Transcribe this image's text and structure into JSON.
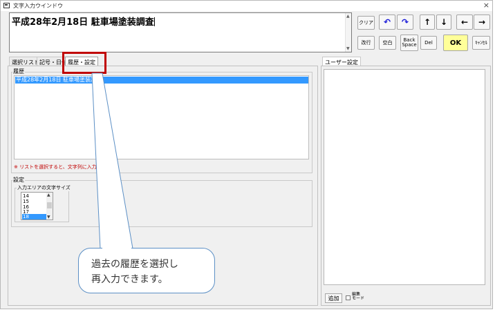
{
  "window": {
    "title": "文字入力ウインドウ",
    "close": "×"
  },
  "input": {
    "text": "平成28年2月18日 駐車場塗装調査"
  },
  "buttons": {
    "clear": "クリア",
    "undo": "↶",
    "redo": "↷",
    "up": "↑",
    "down": "↓",
    "left": "←",
    "right": "→",
    "newline": "改行",
    "space": "空白",
    "backspace_1": "Back",
    "backspace_2": "Space",
    "del": "Del",
    "ok": "OK",
    "cancel": "ｷｬﾝｾﾙ"
  },
  "tabs": [
    "選択リスト",
    "記号・日付",
    "履歴・設定"
  ],
  "history": {
    "group_label": "履歴",
    "items": [
      "平成28年2月18日 駐車場塗装調査"
    ],
    "note": "※ リストを選択すると、文字列に入力されます。"
  },
  "settings": {
    "group_label": "設定",
    "font_group_label": "入力エリアの文字サイズ",
    "font_sizes": [
      "14",
      "15",
      "16",
      "17",
      "18"
    ],
    "selected_font_size": "18"
  },
  "callout": {
    "line1": "過去の履歴を選択し",
    "line2": "再入力できます。"
  },
  "user_settings": {
    "tab_label": "ユーザー設定",
    "add_label": "追加",
    "edit_mode_1": "編集",
    "edit_mode_2": "モード"
  },
  "colors": {
    "highlight": "#c00000",
    "selection": "#3399ff",
    "ok_button": "#ffff99",
    "note": "#c00000"
  }
}
